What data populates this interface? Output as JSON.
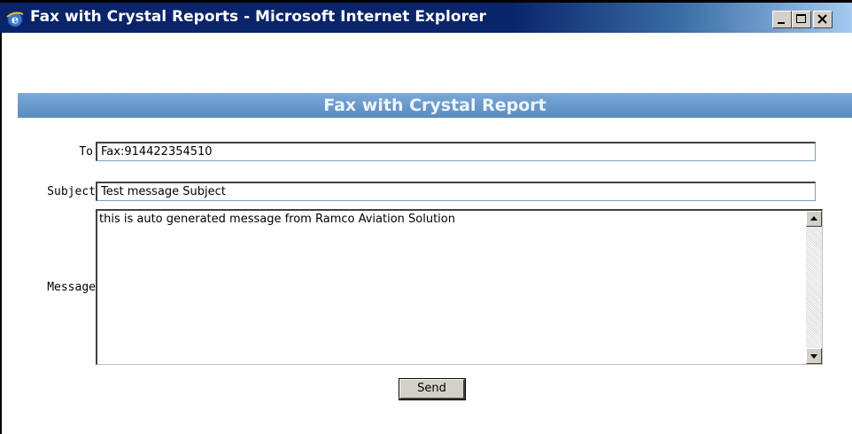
{
  "window": {
    "title": "Fax with Crystal Reports - Microsoft Internet Explorer"
  },
  "form": {
    "header": "Fax with Crystal Report",
    "to_label": "To",
    "to_value": "Fax:914422354510",
    "subject_label": "Subject",
    "subject_value": "Test message Subject",
    "message_label": "Message",
    "message_value": "this is auto generated message from Ramco Aviation Solution",
    "send_label": "Send"
  },
  "colors": {
    "titlebar": "#0a246a",
    "header_bar": "#6496c8",
    "button_face": "#d4d0c8"
  },
  "icons": [
    "ie-icon",
    "minimize-icon",
    "maximize-icon",
    "close-icon",
    "scroll-up-icon",
    "scroll-down-icon"
  ]
}
